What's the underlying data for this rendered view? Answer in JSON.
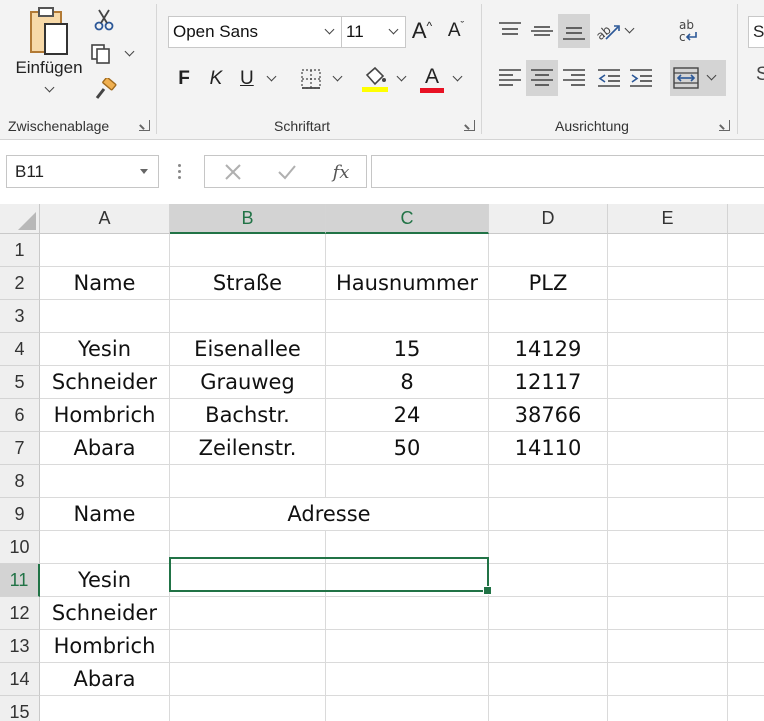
{
  "ribbon": {
    "clipboard": {
      "paste_label": "Einfügen",
      "group_label": "Zwischenablage"
    },
    "font": {
      "font_name": "Open Sans",
      "font_size": "11",
      "grow_label": "A",
      "shrink_label": "A",
      "bold_label": "F",
      "italic_label": "K",
      "underline_label": "U",
      "color_label": "A",
      "highlight_color": "#ffff00",
      "font_color": "#e81123",
      "group_label": "Schriftart"
    },
    "alignment": {
      "group_label": "Ausrichtung"
    },
    "styles": {
      "partial_label_1": "St",
      "partial_label_2": "S"
    }
  },
  "formula_bar": {
    "name_box": "B11",
    "fx_label": "fx",
    "formula": ""
  },
  "grid": {
    "columns": [
      "A",
      "B",
      "C",
      "D",
      "E"
    ],
    "selected_column_letters": [
      "B",
      "C"
    ],
    "rows": [
      "1",
      "2",
      "3",
      "4",
      "5",
      "6",
      "7",
      "8",
      "9",
      "10",
      "11",
      "12",
      "13",
      "14",
      "15"
    ],
    "selected_row": "11",
    "cells": {
      "A2": "Name",
      "B2": "Straße",
      "C2": "Hausnummer",
      "D2": "PLZ",
      "A4": "Yesin",
      "B4": "Eisenallee",
      "C4": "15",
      "D4": "14129",
      "A5": "Schneider",
      "B5": "Grauweg",
      "C5": "8",
      "D5": "12117",
      "A6": "Hombrich",
      "B6": "Bachstr.",
      "C6": "24",
      "D6": "38766",
      "A7": "Abara",
      "B7": "Zeilenstr.",
      "C7": "50",
      "D7": "14110",
      "A9": "Name",
      "BC9": "Adresse",
      "A11": "Yesin",
      "A12": "Schneider",
      "A13": "Hombrich",
      "A14": "Abara"
    },
    "accent_color": "#217346"
  }
}
